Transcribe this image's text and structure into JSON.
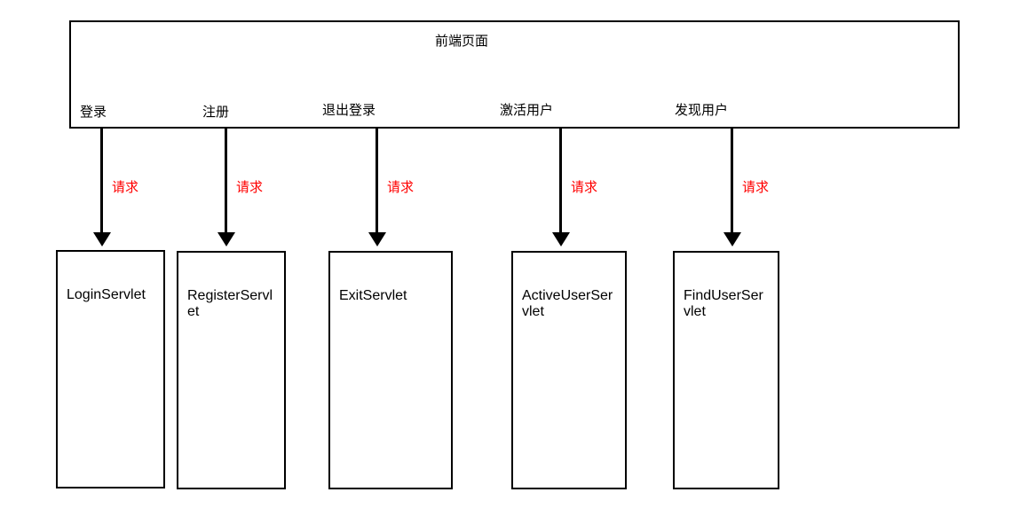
{
  "frontend": {
    "title": "前端页面",
    "actions": [
      {
        "label": "登录"
      },
      {
        "label": "注册"
      },
      {
        "label": "退出登录"
      },
      {
        "label": "激活用户"
      },
      {
        "label": "发现用户"
      }
    ]
  },
  "arrows": {
    "label": "请求"
  },
  "servlets": [
    {
      "name": "LoginServlet"
    },
    {
      "name": "RegisterServlet"
    },
    {
      "name": "ExitServlet"
    },
    {
      "name": "ActiveUserServlet"
    },
    {
      "name": "FindUserServlet"
    }
  ]
}
